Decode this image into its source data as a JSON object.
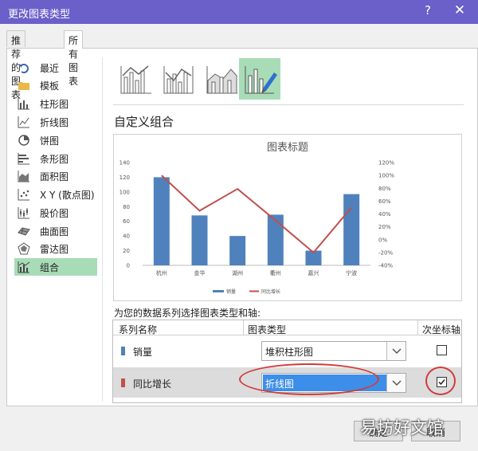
{
  "window": {
    "title": "更改图表类型",
    "help_glyph": "?",
    "close_glyph": "✕"
  },
  "tabs": [
    {
      "label": "推荐的图表",
      "active": false
    },
    {
      "label": "所有图表",
      "active": true
    }
  ],
  "sidebar": {
    "items": [
      {
        "label": "最近",
        "icon": "undo-icon"
      },
      {
        "label": "模板",
        "icon": "folder-icon"
      },
      {
        "label": "柱形图",
        "icon": "column-chart-icon"
      },
      {
        "label": "折线图",
        "icon": "line-chart-icon"
      },
      {
        "label": "饼图",
        "icon": "pie-chart-icon"
      },
      {
        "label": "条形图",
        "icon": "bar-chart-icon"
      },
      {
        "label": "面积图",
        "icon": "area-chart-icon"
      },
      {
        "label": "X Y (散点图)",
        "icon": "scatter-chart-icon"
      },
      {
        "label": "股价图",
        "icon": "stock-chart-icon"
      },
      {
        "label": "曲面图",
        "icon": "surface-chart-icon"
      },
      {
        "label": "雷达图",
        "icon": "radar-chart-icon"
      },
      {
        "label": "组合",
        "icon": "combo-chart-icon",
        "selected": true
      }
    ]
  },
  "subtypes": [
    {
      "icon": "combo-column-line-icon"
    },
    {
      "icon": "combo-column-line-secondary-icon"
    },
    {
      "icon": "combo-area-column-icon"
    },
    {
      "icon": "custom-combo-icon",
      "selected": true
    }
  ],
  "section_title": "自定义组合",
  "chart_data": {
    "type": "bar",
    "title": "图表标题",
    "categories": [
      "杭州",
      "金华",
      "湖州",
      "衢州",
      "嘉兴",
      "宁波"
    ],
    "series": [
      {
        "name": "销量",
        "type": "bar",
        "axis": "primary",
        "color": "#4f81bd",
        "values": [
          120,
          68,
          40,
          69,
          20,
          97
        ]
      },
      {
        "name": "同比增长",
        "type": "line",
        "axis": "secondary",
        "color": "#c0504d",
        "values": [
          1.0,
          0.45,
          0.79,
          0.3,
          -0.2,
          0.5
        ]
      }
    ],
    "ylim": [
      0,
      140
    ],
    "y_ticks": [
      "0",
      "20",
      "40",
      "60",
      "80",
      "100",
      "120",
      "140"
    ],
    "y2lim": [
      -0.4,
      1.2
    ],
    "y2_ticks": [
      "-40%",
      "-20%",
      "0%",
      "20%",
      "40%",
      "60%",
      "80%",
      "100%",
      "120%"
    ],
    "grid": false,
    "legend": "bottom"
  },
  "series_prompt": "为您的数据系列选择图表类型和轴:",
  "table": {
    "headers": {
      "name": "系列名称",
      "type": "图表类型",
      "secondary": "次坐标轴"
    },
    "rows": [
      {
        "name": "销量",
        "color": "#4f81bd",
        "chart_type": "堆积柱形图",
        "secondary_axis": false
      },
      {
        "name": "同比增长",
        "color": "#c0504d",
        "chart_type": "折线图",
        "secondary_axis": true
      }
    ]
  },
  "buttons": {
    "ok": "确定",
    "cancel": "取消"
  },
  "watermark": "易坊好文馆",
  "colors": {
    "titlebar": "#6b5fc9",
    "selected": "#a8dcb6",
    "highlight": "#3d8ee8",
    "annotation": "#d13b3b"
  }
}
